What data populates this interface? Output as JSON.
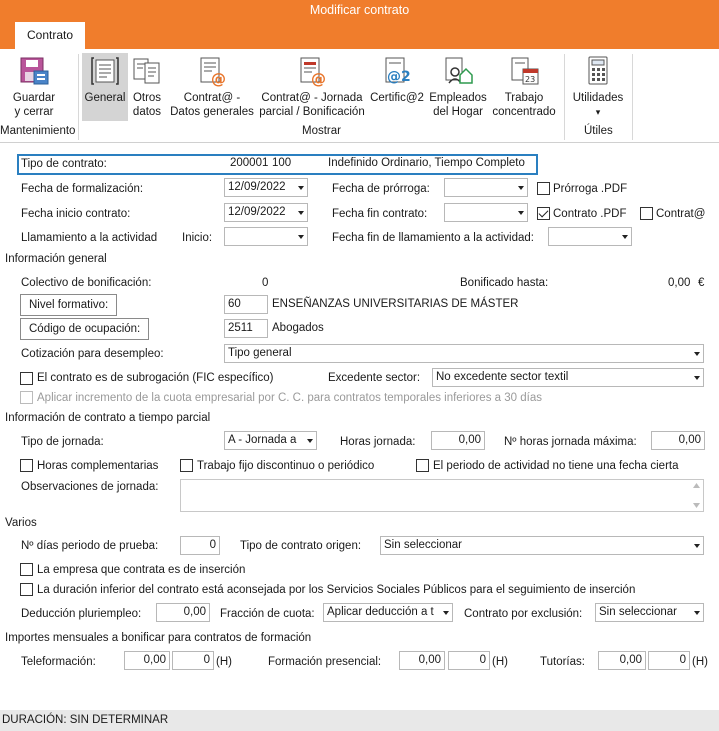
{
  "window": {
    "title": "Modificar contrato"
  },
  "tabs": {
    "active": "Contrato"
  },
  "ribbon": {
    "guardar": "Guardar\ny cerrar",
    "general": "General",
    "otros": "Otros\ndatos",
    "contrata_generales": "Contrat@ -\nDatos generales",
    "contrata_jornada": "Contrat@ - Jornada\nparcial / Bonificación",
    "certifica": "Certific@2",
    "empleados_hogar": "Empleados\ndel Hogar",
    "trabajo_concentrado": "Trabajo\nconcentrado",
    "utilidades": "Utilidades",
    "utilidades_arrow": "▾",
    "group_mantenimiento": "Mantenimiento",
    "group_mostrar": "Mostrar",
    "group_utiles": "Útiles"
  },
  "form": {
    "tipo_contrato_label": "Tipo de contrato:",
    "tipo_contrato_code": "200001",
    "tipo_contrato_num": "100",
    "tipo_contrato_desc": "Indefinido Ordinario, Tiempo Completo",
    "fecha_formalizacion_label": "Fecha de formalización:",
    "fecha_formalizacion": "12/09/2022",
    "fecha_prorroga_label": "Fecha de prórroga:",
    "fecha_prorroga": "",
    "prorroga_pdf_label": "Prórroga .PDF",
    "fecha_inicio_label": "Fecha inicio contrato:",
    "fecha_inicio": "12/09/2022",
    "fecha_fin_label": "Fecha fin contrato:",
    "fecha_fin": "",
    "contrato_pdf_label": "Contrato .PDF",
    "contrata_label": "Contrat@",
    "llamamiento_label": "Llamamiento a la actividad",
    "inicio_label": "Inicio:",
    "inicio_value": "",
    "fecha_fin_llamamiento_label": "Fecha fin de llamamiento a la actividad:",
    "fecha_fin_llamamiento": ""
  },
  "informacion_general": {
    "title": "Información general",
    "colectivo_label": "Colectivo de bonificación:",
    "colectivo_value": "0",
    "bonificado_label": "Bonificado hasta:",
    "bonificado_value": "0,00",
    "bonificado_unit": "€",
    "nivel_formativo_btn": "Nivel formativo:",
    "nivel_formativo_code": "60",
    "nivel_formativo_desc": "ENSEÑANZAS UNIVERSITARIAS DE MÁSTER",
    "codigo_ocupacion_btn": "Código de ocupación:",
    "codigo_ocupacion_code": "2511",
    "codigo_ocupacion_desc": "Abogados",
    "cotizacion_label": "Cotización para desempleo:",
    "cotizacion_value": "Tipo general",
    "subrogacion_label": "El contrato es de subrogación (FIC específico)",
    "excedente_label": "Excedente sector:",
    "excedente_value": "No excedente sector textil",
    "aplicar_incremento_label": "Aplicar incremento de la cuota empresarial por C. C. para contratos temporales inferiores a 30 días"
  },
  "tiempo_parcial": {
    "title": "Información de contrato a tiempo parcial",
    "tipo_jornada_label": "Tipo de jornada:",
    "tipo_jornada_value": "A - Jornada a",
    "horas_jornada_label": "Horas jornada:",
    "horas_jornada_value": "0,00",
    "horas_max_label": "Nº horas jornada máxima:",
    "horas_max_value": "0,00",
    "horas_complementarias_label": "Horas complementarias",
    "trabajo_fijo_label": "Trabajo fijo discontinuo o periódico",
    "periodo_actividad_label": "El periodo de actividad no tiene una fecha cierta",
    "observaciones_label": "Observaciones de jornada:"
  },
  "varios": {
    "title": "Varios",
    "dias_prueba_label": "Nº días periodo de prueba:",
    "dias_prueba_value": "0",
    "tipo_origen_label": "Tipo de contrato origen:",
    "tipo_origen_value": "Sin seleccionar",
    "empresa_insercion_label": "La empresa que contrata es de inserción",
    "duracion_inferior_label": "La duración inferior del contrato está aconsejada por los Servicios Sociales Públicos para el seguimiento de inserción",
    "deduccion_label": "Deducción pluriempleo:",
    "deduccion_value": "0,00",
    "fraccion_label": "Fracción de cuota:",
    "fraccion_value": "Aplicar deducción a t",
    "exclusion_label": "Contrato por exclusión:",
    "exclusion_value": "Sin seleccionar"
  },
  "importes": {
    "title": "Importes mensuales a bonificar para contratos de formación",
    "teleformacion_label": "Teleformación:",
    "teleformacion_value": "0,00",
    "teleformacion_h": "0",
    "presencial_label": "Formación presencial:",
    "presencial_value": "0,00",
    "presencial_h": "0",
    "tutorias_label": "Tutorías:",
    "tutorias_value": "0,00",
    "tutorias_h": "0",
    "h_unit": "(H)"
  },
  "status": {
    "text": "DURACIÓN: SIN DETERMINAR"
  },
  "colors": {
    "accent": "#f07d2c",
    "focus": "#2a7fc0"
  }
}
